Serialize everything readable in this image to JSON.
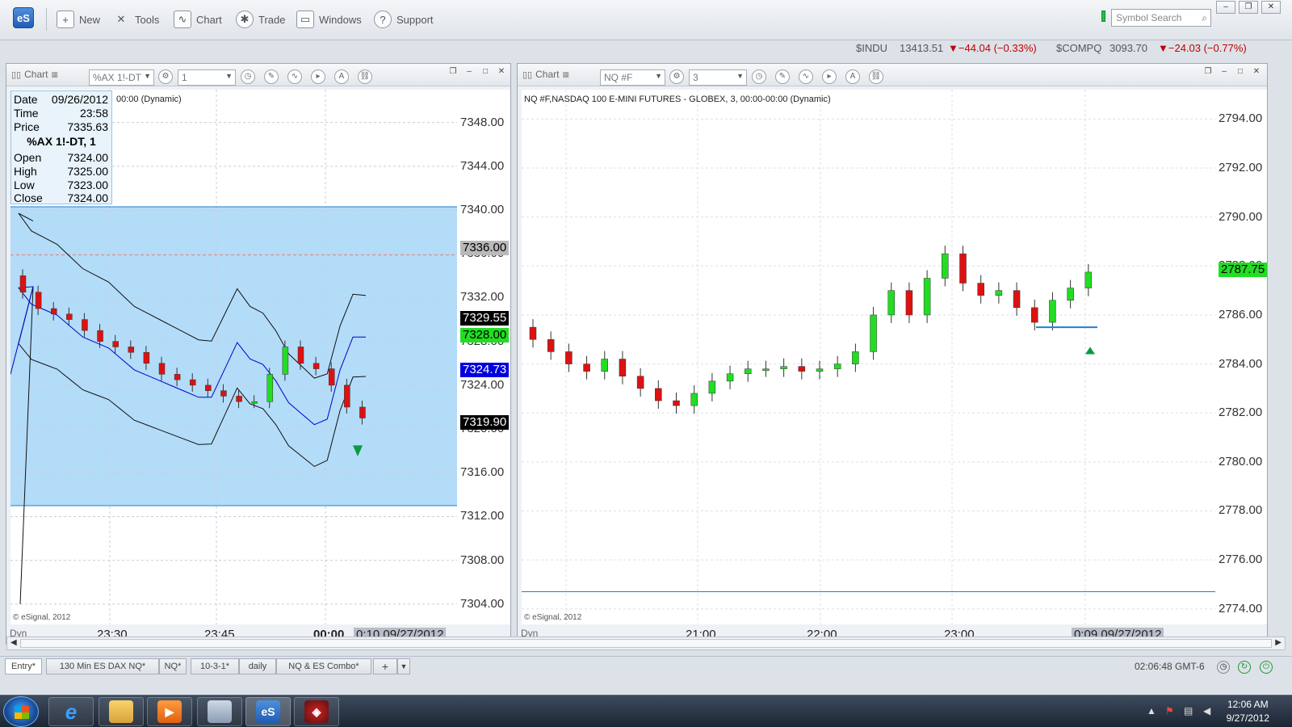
{
  "toolbar": {
    "logo": "eS",
    "new_label": "New",
    "tools_label": "Tools",
    "chart_label": "Chart",
    "trade_label": "Trade",
    "windows_label": "Windows",
    "support_label": "Support",
    "symbol_search_placeholder": "Symbol Search"
  },
  "ticker": {
    "indu_symbol": "$INDU",
    "indu_price": "13413.51",
    "indu_change": "▼−44.04 (−0.33%)",
    "compq_symbol": "$COMPQ",
    "compq_price": "3093.70",
    "compq_change": "▼−24.03 (−0.77%)"
  },
  "colors": {
    "up": "#22dd22",
    "down": "#dd1111",
    "band": "#b3dcf8",
    "accent_blue": "#1f7fd6"
  },
  "left_chart": {
    "title": "Chart",
    "symbol": "%AX 1!-DT",
    "interval": "1",
    "header_text": "00:00 (Dynamic)",
    "copyright": "© eSignal, 2012",
    "dyn": "Dyn",
    "time_labels": [
      "23:30",
      "23:45",
      "00:00"
    ],
    "current_time": "0:10 09/27/2012",
    "price_labels": [
      "7348.00",
      "7344.00",
      "7340.00",
      "7336.00",
      "7332.00",
      "7328.00",
      "7324.00",
      "7320.00",
      "7316.00",
      "7312.00",
      "7308.00",
      "7304.00"
    ],
    "markers": {
      "m1": "7336.00",
      "m2": "7329.55",
      "m3": "7328.00",
      "m4": "7324.73",
      "m5": "7319.90"
    },
    "data_window": {
      "date_label": "Date",
      "date": "09/26/2012",
      "time_label": "Time",
      "time": "23:58",
      "price_label": "Price",
      "price": "7335.63",
      "symbol": "%AX 1!-DT, 1",
      "open_label": "Open",
      "open": "7324.00",
      "high_label": "High",
      "high": "7325.00",
      "low_label": "Low",
      "low": "7323.00",
      "close_label": "Close",
      "close": "7324.00"
    }
  },
  "right_chart": {
    "title": "Chart",
    "symbol": "NQ #F",
    "interval": "3",
    "header_text": "NQ #F,NASDAQ 100 E-MINI FUTURES - GLOBEX, 3, 00:00-00:00 (Dynamic)",
    "copyright": "© eSignal, 2012",
    "dyn": "Dyn",
    "time_labels": [
      "21:00",
      "22:00",
      "23:00"
    ],
    "current_time": "0:09 09/27/2012",
    "price_labels": [
      "2794.00",
      "2792.00",
      "2790.00",
      "2788.00",
      "2786.00",
      "2784.00",
      "2782.00",
      "2780.00",
      "2778.00",
      "2776.00",
      "2774.00"
    ],
    "last_price": "2787.75"
  },
  "tabs": [
    "Entry*",
    "130 Min ES DAX NQ*",
    "NQ*",
    "10-3-1*",
    "daily",
    "NQ & ES Combo*"
  ],
  "status": {
    "clock": "02:06:48 GMT-6"
  },
  "taskbar": {
    "time": "12:06 AM",
    "date": "9/27/2012"
  },
  "chart_data": [
    {
      "type": "candlestick",
      "symbol": "%AX 1!-DT",
      "ylim": [
        7302,
        7351
      ],
      "x": [
        "23:30",
        "23:45",
        "00:00"
      ],
      "candles_close": [
        7332.5,
        7331,
        7330.5,
        7330,
        7329,
        7328,
        7327.5,
        7327,
        7326,
        7325,
        7324.5,
        7324,
        7323.5,
        7323,
        7322.5,
        7322.5,
        7325,
        7327.5,
        7326,
        7325.5,
        7324,
        7322,
        7321,
        7320,
        7320.5,
        7325,
        7328
      ],
      "bands": {
        "upper_start": 7339,
        "lower_start": 7333,
        "end_upper": 7329.5,
        "end_lower": 7319.9,
        "ma_end": 7324.73
      }
    },
    {
      "type": "candlestick",
      "symbol": "NQ #F",
      "ylim": [
        2773.3,
        2795.2
      ],
      "x": [
        "21:00",
        "22:00",
        "23:00"
      ],
      "candles_close": [
        2785,
        2784.5,
        2784,
        2783.7,
        2784.2,
        2783.5,
        2783,
        2782.5,
        2782.3,
        2782.8,
        2783.3,
        2783.6,
        2783.8,
        2783.8,
        2783.9,
        2783.7,
        2783.8,
        2784,
        2784.5,
        2786,
        2787,
        2786,
        2787.5,
        2788.5,
        2787.3,
        2786.8,
        2787,
        2786.3,
        2785.7,
        2786.6,
        2787.1,
        2787.75
      ],
      "support_line": 2785.5,
      "bottom_line": 2774.7
    }
  ]
}
